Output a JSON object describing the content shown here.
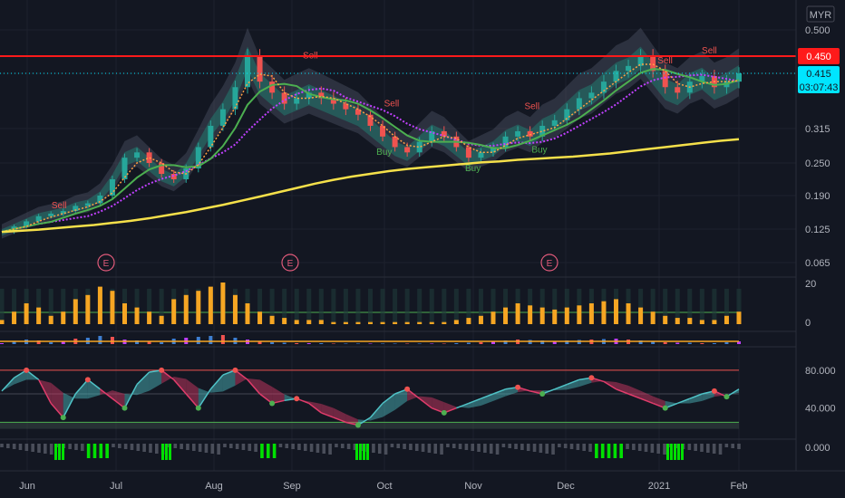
{
  "currency": "MYR",
  "colors": {
    "background": "#131722",
    "grid": "#1e222d",
    "up": "#26a69a",
    "down": "#ef5350",
    "resistance": "#ff1a1a",
    "ma_long": "#f5e04a",
    "ma_fast": "#ff9f43",
    "ma_mid": "#4caf50",
    "ma_slow": "#c040ff",
    "volume": "#f6a623",
    "cyan": "#00e5ff",
    "rsi_up": "#4fc3c7",
    "rsi_down": "#e03c6b",
    "hist_green": "#00e000"
  },
  "last_price_badge": "0.415",
  "countdown_badge": "03:07:43",
  "resistance_badge": "0.450",
  "chart_data": [
    {
      "type": "candlestick",
      "title": "",
      "x": [
        "Jun",
        "Jul",
        "Aug",
        "Sep",
        "Oct",
        "Nov",
        "Dec",
        "2021",
        "Feb"
      ],
      "yticks": [
        "0.500",
        "0.450",
        "0.415",
        "0.315",
        "0.250",
        "0.190",
        "0.125",
        "0.065"
      ],
      "ylim": [
        0.04,
        0.52
      ],
      "resistance": 0.45,
      "last_price": 0.415,
      "earnings_markers": [
        "E",
        "E",
        "E"
      ],
      "signals": [
        {
          "label": "Sell",
          "x": 0.08,
          "y": 0.165
        },
        {
          "label": "Sell",
          "x": 0.42,
          "y": 0.445
        },
        {
          "label": "Sell",
          "x": 0.53,
          "y": 0.355
        },
        {
          "label": "Buy",
          "x": 0.52,
          "y": 0.265
        },
        {
          "label": "Buy",
          "x": 0.64,
          "y": 0.235
        },
        {
          "label": "Sell",
          "x": 0.72,
          "y": 0.35
        },
        {
          "label": "Buy",
          "x": 0.73,
          "y": 0.27
        },
        {
          "label": "Sell",
          "x": 0.9,
          "y": 0.435
        },
        {
          "label": "Sell",
          "x": 0.96,
          "y": 0.455
        }
      ],
      "close_series": [
        0.12,
        0.13,
        0.14,
        0.15,
        0.155,
        0.16,
        0.17,
        0.175,
        0.19,
        0.22,
        0.26,
        0.27,
        0.25,
        0.23,
        0.22,
        0.24,
        0.28,
        0.32,
        0.35,
        0.39,
        0.45,
        0.4,
        0.38,
        0.36,
        0.37,
        0.38,
        0.37,
        0.36,
        0.35,
        0.34,
        0.32,
        0.3,
        0.28,
        0.27,
        0.29,
        0.31,
        0.3,
        0.28,
        0.26,
        0.27,
        0.28,
        0.3,
        0.31,
        0.3,
        0.32,
        0.33,
        0.35,
        0.37,
        0.38,
        0.4,
        0.42,
        0.43,
        0.45,
        0.42,
        0.39,
        0.38,
        0.4,
        0.41,
        0.39,
        0.4,
        0.415
      ],
      "ma_long": [
        0.12,
        0.122,
        0.124,
        0.127,
        0.13,
        0.133,
        0.137,
        0.141,
        0.146,
        0.152,
        0.158,
        0.165,
        0.172,
        0.18,
        0.188,
        0.196,
        0.204,
        0.212,
        0.219,
        0.225,
        0.23,
        0.235,
        0.239,
        0.242,
        0.245,
        0.248,
        0.251,
        0.253,
        0.256,
        0.258,
        0.26,
        0.262,
        0.265,
        0.268,
        0.272,
        0.276,
        0.28,
        0.284,
        0.288,
        0.292,
        0.295
      ],
      "volume_yticks": [
        "20",
        "0"
      ],
      "volume": [
        2,
        6,
        10,
        8,
        4,
        6,
        12,
        14,
        18,
        16,
        10,
        8,
        6,
        4,
        12,
        14,
        16,
        18,
        20,
        14,
        10,
        6,
        4,
        3,
        2,
        2,
        2,
        1,
        1,
        1,
        1,
        1,
        1,
        1,
        1,
        1,
        1,
        2,
        3,
        4,
        6,
        8,
        10,
        9,
        8,
        7,
        8,
        9,
        10,
        11,
        12,
        10,
        8,
        6,
        4,
        3,
        3,
        2,
        2,
        4,
        6
      ]
    },
    {
      "type": "line",
      "title": "",
      "yticks": [
        "80.000",
        "40.000"
      ],
      "ylim": [
        10,
        100
      ],
      "overbought": 80,
      "mid": 55,
      "oversold": 25,
      "values": [
        58,
        72,
        80,
        70,
        45,
        30,
        55,
        70,
        60,
        50,
        40,
        65,
        78,
        80,
        70,
        55,
        40,
        60,
        75,
        80,
        70,
        55,
        45,
        48,
        50,
        45,
        35,
        30,
        25,
        22,
        30,
        45,
        55,
        60,
        50,
        40,
        35,
        40,
        45,
        50,
        55,
        60,
        62,
        58,
        55,
        60,
        65,
        70,
        72,
        68,
        60,
        55,
        50,
        45,
        40,
        45,
        50,
        55,
        58,
        52,
        60
      ]
    },
    {
      "type": "bar",
      "title": "",
      "yticks": [
        "0.000"
      ]
    }
  ]
}
